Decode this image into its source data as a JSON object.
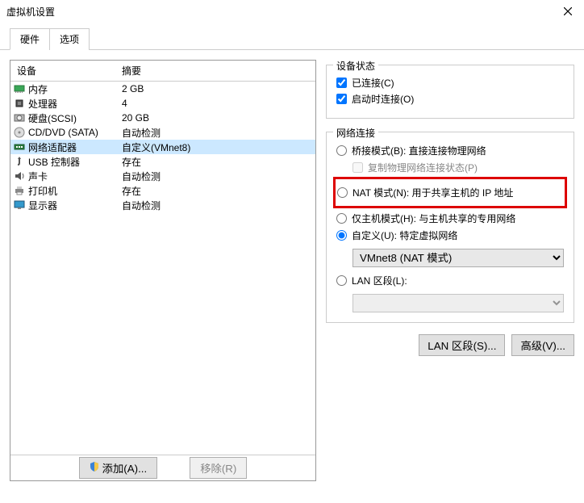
{
  "window": {
    "title": "虚拟机设置"
  },
  "tabs": {
    "hardware": "硬件",
    "options": "选项"
  },
  "table": {
    "header_device": "设备",
    "header_summary": "摘要",
    "rows": [
      {
        "icon": "memory",
        "name": "内存",
        "summary": "2 GB"
      },
      {
        "icon": "cpu",
        "name": "处理器",
        "summary": "4"
      },
      {
        "icon": "hdd",
        "name": "硬盘(SCSI)",
        "summary": "20 GB"
      },
      {
        "icon": "disc",
        "name": "CD/DVD (SATA)",
        "summary": "自动检测"
      },
      {
        "icon": "nic",
        "name": "网络适配器",
        "summary": "自定义(VMnet8)"
      },
      {
        "icon": "usb",
        "name": "USB 控制器",
        "summary": "存在"
      },
      {
        "icon": "sound",
        "name": "声卡",
        "summary": "自动检测"
      },
      {
        "icon": "printer",
        "name": "打印机",
        "summary": "存在"
      },
      {
        "icon": "monitor",
        "name": "显示器",
        "summary": "自动检测"
      }
    ],
    "selected_index": 4
  },
  "footer": {
    "add": "添加(A)...",
    "remove": "移除(R)"
  },
  "device_state": {
    "group_title": "设备状态",
    "connected": "已连接(C)",
    "connect_at_power": "启动时连接(O)"
  },
  "net": {
    "group_title": "网络连接",
    "bridged": "桥接模式(B): 直接连接物理网络",
    "replicate": "复制物理网络连接状态(P)",
    "nat": "NAT 模式(N): 用于共享主机的 IP 地址",
    "hostonly": "仅主机模式(H): 与主机共享的专用网络",
    "custom": "自定义(U): 特定虚拟网络",
    "custom_select": "VMnet8 (NAT 模式)",
    "lan_segment": "LAN 区段(L):",
    "lan_select": ""
  },
  "buttons": {
    "lan": "LAN 区段(S)...",
    "advanced": "高级(V)..."
  }
}
